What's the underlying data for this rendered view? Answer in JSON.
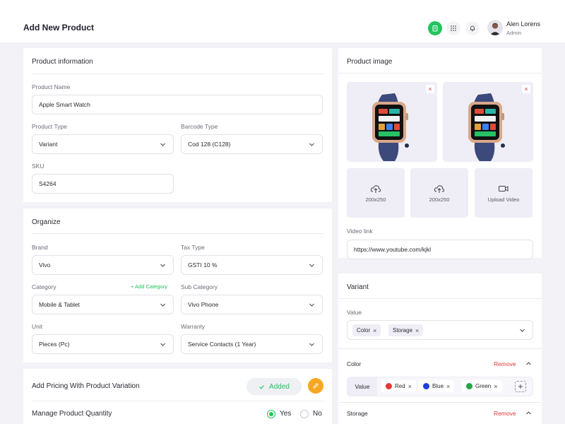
{
  "header": {
    "title": "Add New Product",
    "user_name": "Alen Lorens",
    "user_role": "Admin"
  },
  "product_info": {
    "title": "Product information",
    "name_label": "Product Name",
    "name_value": "Apple Smart Watch",
    "type_label": "Product Type",
    "type_value": "Variant",
    "barcode_label": "Barcode Type",
    "barcode_value": "Cod 128 (C128)",
    "sku_label": "SKU",
    "sku_value": "S4264"
  },
  "organize": {
    "title": "Organize",
    "brand_label": "Brand",
    "brand_value": "Vivo",
    "tax_label": "Tax Type",
    "tax_value": "GSTI 10 %",
    "category_label": "Category",
    "add_category": "+ Add Category",
    "category_value": "Mobile & Tablet",
    "subcategory_label": "Sub Category",
    "subcategory_value": "Vivo Phone",
    "unit_label": "Unit",
    "unit_value": "Pieces (Pc)",
    "warranty_label": "Warranty",
    "warranty_value": "Service Contacts (1 Year)"
  },
  "pricing": {
    "variation_label": "Add Pricing With Product Variation",
    "added_label": "Added",
    "quantity_label": "Manage Product Quantity",
    "yes_label": "Yes",
    "no_label": "No"
  },
  "product_image": {
    "title": "Product image",
    "upload1": "200x250",
    "upload2": "200x250",
    "upload_video": "Upload Video",
    "video_label": "Video link",
    "video_value": "https://www.youtube.com/kjkl"
  },
  "variant": {
    "title": "Variant",
    "value_label": "Value",
    "chips": [
      "Color",
      "Storage"
    ],
    "color_label": "Color",
    "remove_label": "Remove",
    "value_chip_label": "Value",
    "colors": [
      {
        "name": "Red",
        "color": "#e53935"
      },
      {
        "name": "Blue",
        "color": "#1e40d8"
      },
      {
        "name": "Green",
        "color": "#22a845"
      }
    ],
    "storage_label": "Storage"
  },
  "colors": {
    "accent": "#22c55e",
    "danger": "#e0393e",
    "edit": "#f6a823"
  }
}
